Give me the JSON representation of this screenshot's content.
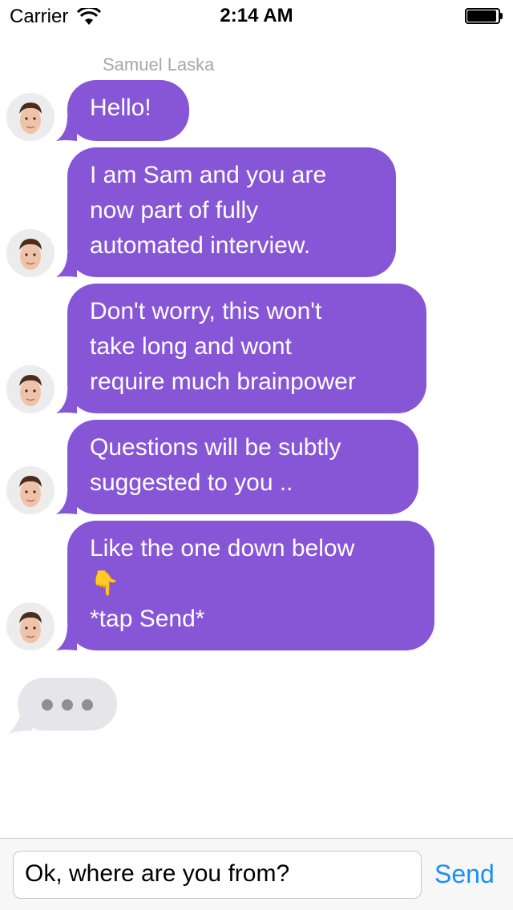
{
  "status_bar": {
    "carrier": "Carrier",
    "time": "2:14 AM",
    "wifi_icon": "wifi-icon",
    "battery_icon": "battery-icon"
  },
  "conversation": {
    "sender_name": "Samuel Laska",
    "bubble_color": "#8656d6",
    "messages": [
      {
        "lines": [
          "Hello!"
        ]
      },
      {
        "lines": [
          "I am Sam and you are",
          "now part of fully",
          "automated interview."
        ]
      },
      {
        "lines": [
          "Don't worry, this won't",
          "take long and wont",
          "require much brainpower"
        ]
      },
      {
        "lines": [
          "Questions will be subtly",
          "suggested to you .."
        ]
      },
      {
        "lines": [
          "Like the one down below",
          "👇",
          "*tap Send*"
        ]
      }
    ],
    "typing_indicator_icon": "ellipsis-icon"
  },
  "input_bar": {
    "value": "Ok, where are you from?",
    "send_label": "Send",
    "send_color": "#1a8ff5"
  }
}
